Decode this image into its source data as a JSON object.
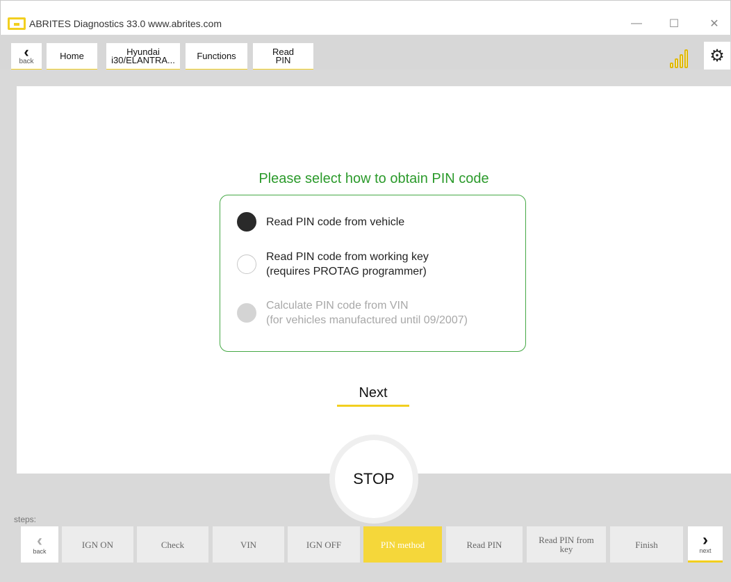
{
  "window": {
    "title": "ABRITES Diagnostics 33.0   www.abrites.com",
    "minimize_glyph": "—",
    "maximize_glyph": "☐",
    "close_glyph": "✕"
  },
  "toolbar": {
    "back_label": "back",
    "breadcrumbs": [
      {
        "label": "Home"
      },
      {
        "label": "Hyundai i30/ELANTRA..."
      },
      {
        "label": "Functions"
      },
      {
        "label": "Read PIN"
      }
    ],
    "signal_icon": "signal-strength-icon",
    "settings_icon": "gear-icon"
  },
  "main": {
    "prompt": "Please select how to obtain PIN code",
    "options": [
      {
        "line1": "Read PIN code from vehicle",
        "line2": "",
        "state": "selected"
      },
      {
        "line1": "Read PIN code from working key",
        "line2": "(requires PROTAG programmer)",
        "state": "unselected"
      },
      {
        "line1": "Calculate PIN code from VIN",
        "line2": "(for vehicles manufactured until 09/2007)",
        "state": "disabled"
      }
    ],
    "next_label": "Next",
    "stop_label": "STOP"
  },
  "steps": {
    "label": "steps:",
    "back_label": "back",
    "next_label": "next",
    "items": [
      {
        "label": "IGN ON"
      },
      {
        "label": "Check"
      },
      {
        "label": "VIN"
      },
      {
        "label": "IGN OFF"
      },
      {
        "label": "PIN method"
      },
      {
        "label": "Read PIN"
      },
      {
        "label": "Read PIN from key"
      },
      {
        "label": "Finish"
      }
    ],
    "active_step": "PIN method"
  },
  "colors": {
    "accent_yellow": "#f2cf1f",
    "prompt_green": "#2b9a2b",
    "active_step": "#f5d73a"
  }
}
